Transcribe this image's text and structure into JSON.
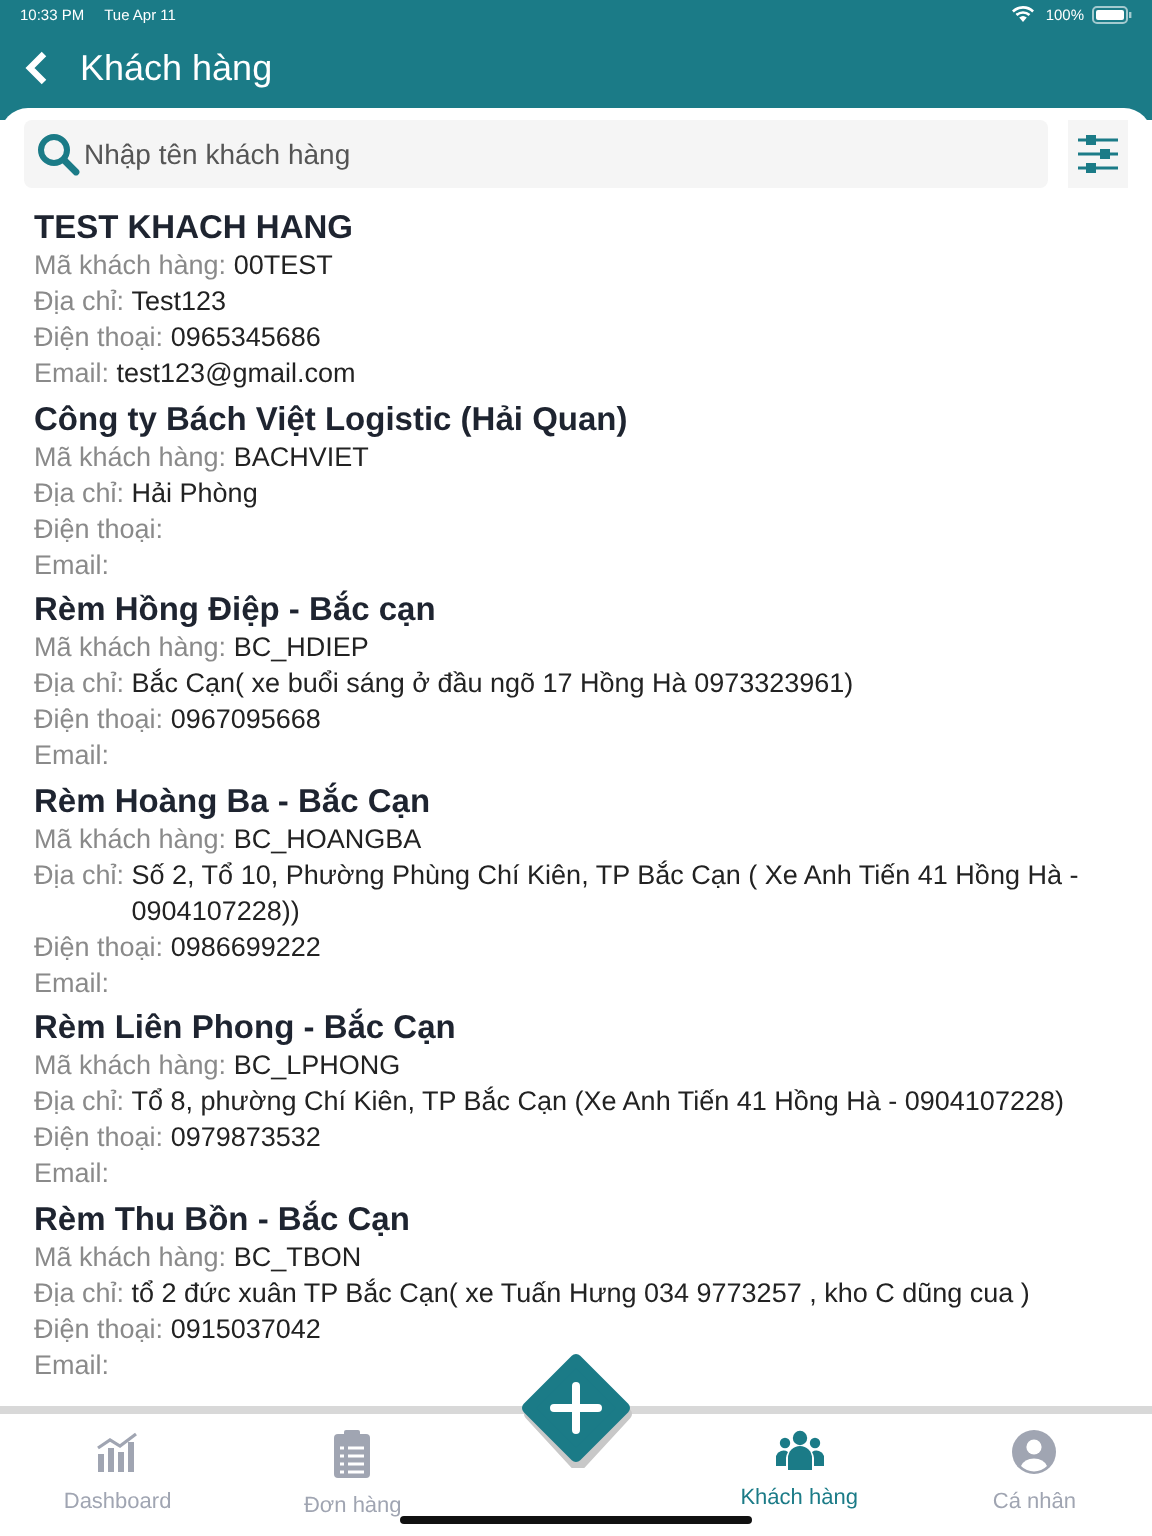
{
  "status_bar": {
    "time": "10:33 PM",
    "date": "Tue Apr 11",
    "battery": "100%"
  },
  "header": {
    "title": "Khách hàng"
  },
  "search": {
    "placeholder": "Nhập tên khách hàng"
  },
  "customers": [
    {
      "name": "TEST KHACH HANG",
      "fields": [
        {
          "label": "Mã khách hàng:",
          "value": "00TEST"
        },
        {
          "label": "Địa chỉ:",
          "value": "Test123"
        },
        {
          "label": "Điện thoại:",
          "value": "0965345686"
        },
        {
          "label": "Email:",
          "value": "test123@gmail.com"
        }
      ]
    },
    {
      "name": "Công ty Bách Việt Logistic (Hải Quan)",
      "fields": [
        {
          "label": "Mã khách hàng:",
          "value": "BACHVIET"
        },
        {
          "label": "Địa chỉ:",
          "value": "Hải Phòng"
        },
        {
          "label": "Điện thoại:"
        },
        {
          "label": "Email:"
        }
      ]
    },
    {
      "name": "Rèm Hồng Điệp - Bắc cạn",
      "fields": [
        {
          "label": "Mã khách hàng:",
          "value": "BC_HDIEP"
        },
        {
          "label": "Địa chỉ:",
          "value": "Bắc Cạn( xe buổi sáng ở đầu ngõ 17 Hồng Hà 0973323961)"
        },
        {
          "label": "Điện thoại:",
          "value": "0967095668"
        },
        {
          "label": "Email:"
        }
      ]
    },
    {
      "name": "Rèm Hoàng Ba - Bắc Cạn",
      "fields": [
        {
          "label": "Mã khách hàng:",
          "value": "BC_HOANGBA"
        },
        {
          "label": "Địa chỉ:",
          "value": "Số 2, Tổ 10, Phường Phùng Chí Kiên, TP Bắc Cạn ( Xe Anh Tiến 41 Hồng Hà - 0904107228))"
        },
        {
          "label": "Điện thoại:",
          "value": "0986699222"
        },
        {
          "label": "Email:"
        }
      ]
    },
    {
      "name": "Rèm Liên Phong - Bắc Cạn",
      "fields": [
        {
          "label": "Mã khách hàng:",
          "value": "BC_LPHONG"
        },
        {
          "label": "Địa chỉ:",
          "value": "Tổ 8, phường Chí Kiên, TP Bắc Cạn (Xe Anh Tiến 41 Hồng Hà - 0904107228)"
        },
        {
          "label": "Điện thoại:",
          "value": "0979873532"
        },
        {
          "label": "Email:"
        }
      ]
    },
    {
      "name": "Rèm Thu Bồn - Bắc Cạn",
      "fields": [
        {
          "label": "Mã khách hàng:",
          "value": "BC_TBON"
        },
        {
          "label": "Địa chỉ:",
          "value": " tổ 2 đức xuân TP Bắc Cạn( xe Tuấn Hưng 034 9773257 , kho C dũng cua )"
        },
        {
          "label": "Điện thoại:",
          "value": "0915037042"
        },
        {
          "label": "Email:"
        }
      ]
    }
  ],
  "tab_bar": [
    {
      "kind": "chart",
      "label": "Dashboard",
      "selected": false
    },
    {
      "kind": "clipboard",
      "label": "Đơn hàng",
      "selected": false
    },
    {
      "kind": "add"
    },
    {
      "kind": "people",
      "label": "Khách hàng",
      "selected": true
    },
    {
      "kind": "person",
      "label": "Cá nhân",
      "selected": false
    }
  ]
}
